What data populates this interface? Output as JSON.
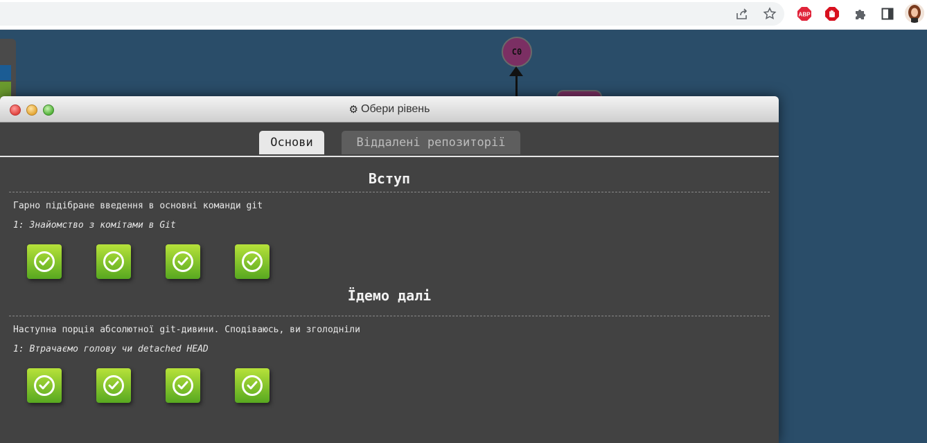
{
  "browser": {
    "toolbar_icons": [
      "share-icon",
      "star-icon",
      "adblock-plus-icon",
      "stop-hand-icon",
      "puzzle-icon",
      "side-panel-icon",
      "profile-avatar"
    ],
    "abp_label": "ABP"
  },
  "graph": {
    "commit_label": "C0",
    "commit_color": "#7b2f63"
  },
  "modal": {
    "title": "Обери рівень",
    "tabs": [
      {
        "label": "Основи",
        "active": true
      },
      {
        "label": "Віддалені репозиторії",
        "active": false
      }
    ],
    "sequences": [
      {
        "title": "Вступ",
        "description": "Гарно підібране введення в основні команди git",
        "selected_level": "1: Знайомство з комітами в Git",
        "levels": [
          {
            "status": "completed"
          },
          {
            "status": "completed"
          },
          {
            "status": "completed"
          },
          {
            "status": "completed"
          }
        ]
      },
      {
        "title": "Їдемо далі",
        "description": "Наступна порція абсолютної git-дивини. Сподіваюсь, ви зголодніли",
        "selected_level": "1: Втрачаємо голову чи detached HEAD",
        "levels": [
          {
            "status": "completed"
          },
          {
            "status": "completed"
          },
          {
            "status": "completed"
          },
          {
            "status": "completed"
          }
        ]
      }
    ]
  },
  "colors": {
    "background": "#2a4d69",
    "modal_bg": "#424242",
    "level_complete": "#57a820"
  }
}
